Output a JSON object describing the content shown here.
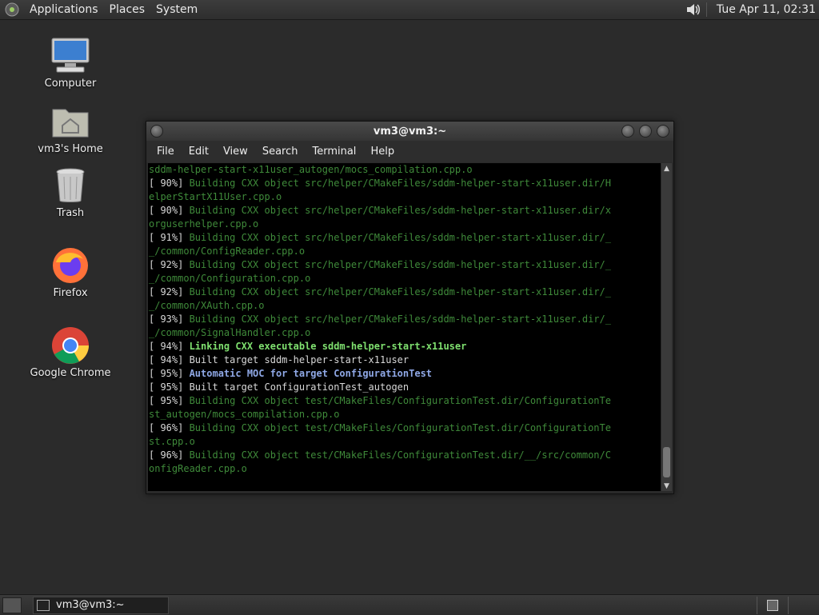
{
  "top_panel": {
    "menus": [
      "Applications",
      "Places",
      "System"
    ],
    "clock": "Tue Apr 11, 02:31"
  },
  "desktop": {
    "icons": [
      {
        "label": "Computer",
        "icon": "computer-icon"
      },
      {
        "label": "vm3's Home",
        "icon": "home-folder-icon"
      },
      {
        "label": "Trash",
        "icon": "trash-icon"
      },
      {
        "label": "Firefox",
        "icon": "firefox-icon"
      },
      {
        "label": "Google Chrome",
        "icon": "chrome-icon"
      }
    ]
  },
  "terminal": {
    "title": "vm3@vm3:~",
    "menus": [
      "File",
      "Edit",
      "View",
      "Search",
      "Terminal",
      "Help"
    ],
    "lines": [
      {
        "p": "",
        "t": "sddm-helper-start-x11user_autogen/mocs_compilation.cpp.o",
        "s": "dim"
      },
      {
        "p": "[ 90%] ",
        "t": "Building CXX object src/helper/CMakeFiles/sddm-helper-start-x11user.dir/H",
        "s": "dim"
      },
      {
        "p": "",
        "t": "elperStartX11User.cpp.o",
        "s": "dim"
      },
      {
        "p": "[ 90%] ",
        "t": "Building CXX object src/helper/CMakeFiles/sddm-helper-start-x11user.dir/x",
        "s": "dim"
      },
      {
        "p": "",
        "t": "orguserhelper.cpp.o",
        "s": "dim"
      },
      {
        "p": "[ 91%] ",
        "t": "Building CXX object src/helper/CMakeFiles/sddm-helper-start-x11user.dir/_",
        "s": "dim"
      },
      {
        "p": "",
        "t": "_/common/ConfigReader.cpp.o",
        "s": "dim"
      },
      {
        "p": "[ 92%] ",
        "t": "Building CXX object src/helper/CMakeFiles/sddm-helper-start-x11user.dir/_",
        "s": "dim"
      },
      {
        "p": "",
        "t": "_/common/Configuration.cpp.o",
        "s": "dim"
      },
      {
        "p": "[ 92%] ",
        "t": "Building CXX object src/helper/CMakeFiles/sddm-helper-start-x11user.dir/_",
        "s": "dim"
      },
      {
        "p": "",
        "t": "_/common/XAuth.cpp.o",
        "s": "dim"
      },
      {
        "p": "[ 93%] ",
        "t": "Building CXX object src/helper/CMakeFiles/sddm-helper-start-x11user.dir/_",
        "s": "dim"
      },
      {
        "p": "",
        "t": "_/common/SignalHandler.cpp.o",
        "s": "dim"
      },
      {
        "p": "[ 94%] ",
        "t": "Linking CXX executable sddm-helper-start-x11user",
        "s": "bold-green"
      },
      {
        "p": "[ 94%] ",
        "t": "Built target sddm-helper-start-x11user",
        "s": "plain"
      },
      {
        "p": "[ 95%] ",
        "t": "Automatic MOC for target ConfigurationTest",
        "s": "bold-blue"
      },
      {
        "p": "[ 95%] ",
        "t": "Built target ConfigurationTest_autogen",
        "s": "plain"
      },
      {
        "p": "[ 95%] ",
        "t": "Building CXX object test/CMakeFiles/ConfigurationTest.dir/ConfigurationTe",
        "s": "dim"
      },
      {
        "p": "",
        "t": "st_autogen/mocs_compilation.cpp.o",
        "s": "dim"
      },
      {
        "p": "[ 96%] ",
        "t": "Building CXX object test/CMakeFiles/ConfigurationTest.dir/ConfigurationTe",
        "s": "dim"
      },
      {
        "p": "",
        "t": "st.cpp.o",
        "s": "dim"
      },
      {
        "p": "[ 96%] ",
        "t": "Building CXX object test/CMakeFiles/ConfigurationTest.dir/__/src/common/C",
        "s": "dim"
      },
      {
        "p": "",
        "t": "onfigReader.cpp.o",
        "s": "dim"
      }
    ]
  },
  "bottom_panel": {
    "task_label": "vm3@vm3:~"
  }
}
